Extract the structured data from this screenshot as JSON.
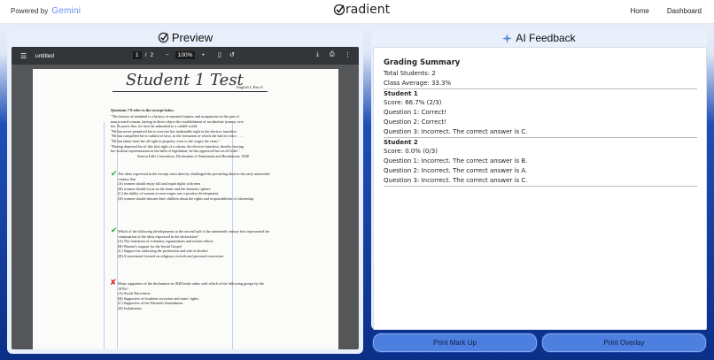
{
  "header": {
    "powered_by": "Powered by",
    "gemini": "Gemini",
    "brand": "radient",
    "nav": [
      "Home",
      "Dashboard"
    ]
  },
  "preview": {
    "title": "Preview",
    "viewer": {
      "file_name": "untitled",
      "page_current": "1",
      "page_sep": "/",
      "page_total": "2",
      "zoom": "100%"
    },
    "document": {
      "handwritten_title": "Student 1 Test",
      "part_label": "English I, Part A",
      "q_intro": "Questions 7-8 refer to the excerpt below.",
      "excerpt": [
        "\"The history of mankind is a history of repeated injuries and usurpations on the part of",
        "man toward woman, having in direct object the establishment of an absolute tyranny over",
        "her. To prove this, let facts be submitted to a candid world.",
        "\"He has never permitted her to exercise her inalienable right to the elective franchise.",
        "\"He has compelled her to submit to laws, in the formation of which she had no voice. . . .",
        "\"He has taken from her all right in property, even to the wages she earns.\"",
        "\"Having deprived her of this first right of a citizen, the elective franchise, thereby leaving",
        "her without representation in the halls of legislation, he has oppressed her on all sides.\"",
        "Seneca Falls Convention, Declaration of Sentiments and Resolutions, 1848"
      ],
      "q1": "The ideas expressed in the excerpt most directly challenged the prevailing ideal in the early nineteenth century that",
      "q1_opts": [
        "(A) women should enjoy full and equal rights with men",
        "(B) women should focus on the home and the domestic sphere",
        "(C) the ability of women to earn wages was a positive development",
        "(D) women should educate their children about the rights and responsibilities of citizenship"
      ],
      "q2": "Which of the following developments in the second half of the nineteenth century best represented the continuation of the ideas expressed in the declaration?",
      "q2_opts": [
        "(A) The formation of voluntary organizations and reform efforts",
        "(B) Women's support for the Social Gospel",
        "(C) Support for outlawing the production and sale of alcohol",
        "(D) A movement focused on religious revivals and personal conversion"
      ],
      "q3": "Many supporters of the declaration in 1848 broke ranks with which of the following groups by the 1870s?",
      "q3_opts": [
        "(A) Social Darwinists",
        "(B) Supporters of Southern secession and states' rights",
        "(C) Supporters of the Fifteenth Amendment",
        "(D) Isolationists"
      ]
    }
  },
  "feedback": {
    "title": "AI Feedback",
    "heading": "Grading Summary",
    "total_students": "Total Students: 2",
    "class_average": "Class Average: 33.3%",
    "students": [
      {
        "name": "Student 1",
        "score": "Score: 66.7% (2/3)",
        "results": [
          "Question 1: Correct!",
          "Question 2: Correct!",
          "Question 3: Incorrect. The correct answer is C."
        ]
      },
      {
        "name": "Student 2",
        "score": "Score: 0.0% (0/3)",
        "results": [
          "Question 1: Incorrect. The correct answer is B.",
          "Question 2: Incorrect. The correct answer is A.",
          "Question 3: Incorrect. The correct answer is C."
        ]
      }
    ]
  },
  "buttons": {
    "print_markup": "Print Mark Up",
    "print_overlay": "Print Overlay"
  },
  "colors": {
    "accent": "#4c7fe0",
    "bg_deep": "#0b2f86",
    "correct_mark": "#2e9e3a",
    "incorrect_mark": "#d42a2a"
  }
}
